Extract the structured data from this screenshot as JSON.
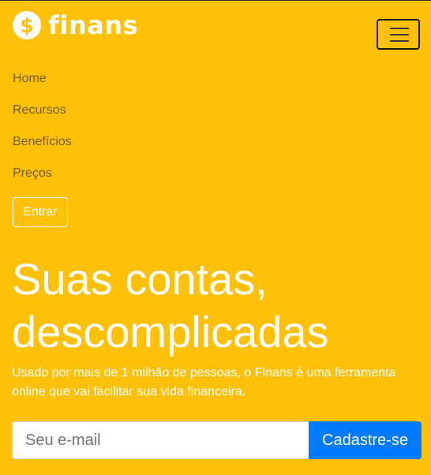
{
  "brand": {
    "icon": "dollar-coin-icon",
    "symbol": "$",
    "name": "finans"
  },
  "navbar": {
    "toggler_icon": "hamburger-icon"
  },
  "menu": {
    "items": [
      {
        "label": "Home"
      },
      {
        "label": "Recursos"
      },
      {
        "label": "Benefícios"
      },
      {
        "label": "Preços"
      }
    ],
    "login_label": "Entrar"
  },
  "hero": {
    "title_line1": "Suas contas,",
    "title_line2": "descomplicadas",
    "subtitle": "Usado por mais de 1 milhão de pessoas, o Finans é uma ferramenta online que vai facilitar sua vida financeira."
  },
  "signup": {
    "email_placeholder": "Seu e-mail",
    "email_value": "",
    "submit_label": "Cadastre-se"
  },
  "colors": {
    "background": "#ffc107",
    "primary_button": "#007bff",
    "text_light": "#ffffff",
    "menu_text": "#6b5b2a"
  }
}
